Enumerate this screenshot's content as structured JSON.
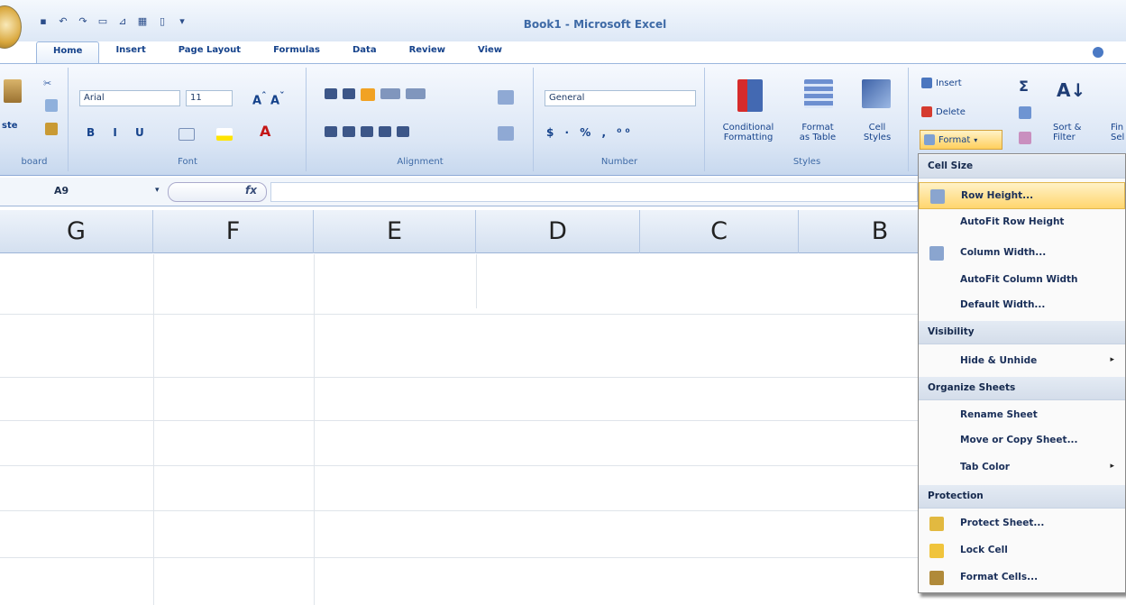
{
  "window": {
    "title": "Book1 - Microsoft Excel"
  },
  "tabs": [
    "Home",
    "Insert",
    "Page Layout",
    "Formulas",
    "Data",
    "Review",
    "View"
  ],
  "ribbon": {
    "clipboard": {
      "paste_label": "ste",
      "group_label": "board"
    },
    "font": {
      "name": "Arial",
      "size": "11",
      "group_label": "Font"
    },
    "alignment": {
      "group_label": "Alignment"
    },
    "number": {
      "format": "General",
      "group_label": "Number"
    },
    "styles": {
      "conditional": "Conditional\nFormatting",
      "format_table": "Format\nas Table",
      "cell_styles": "Cell\nStyles",
      "group_label": "Styles"
    },
    "cells": {
      "insert": "Insert",
      "delete": "Delete",
      "format": "Format"
    },
    "editing": {
      "sigma": "Σ",
      "sort": "Sort &\nFilter",
      "find": "Fin\nSel"
    }
  },
  "formula_bar": {
    "name_box": "A9",
    "fx": "fx",
    "value": ""
  },
  "columns": [
    "G",
    "F",
    "E",
    "D",
    "C",
    "B"
  ],
  "format_menu": {
    "sections": {
      "cell_size": "Cell Size",
      "visibility": "Visibility",
      "organize": "Organize Sheets",
      "protection": "Protection"
    },
    "items": {
      "row_height": "Row Height...",
      "autofit_row": "AutoFit Row Height",
      "column_width": "Column Width...",
      "autofit_col": "AutoFit Column Width",
      "default_width": "Default Width...",
      "hide_unhide": "Hide & Unhide",
      "rename": "Rename Sheet",
      "move_copy": "Move or Copy Sheet...",
      "tab_color": "Tab Color",
      "protect": "Protect Sheet...",
      "lock": "Lock Cell",
      "format_cells": "Format Cells..."
    }
  }
}
